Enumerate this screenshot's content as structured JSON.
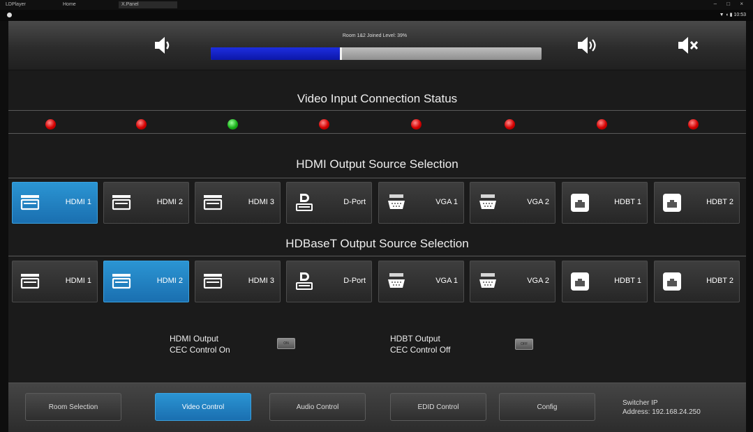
{
  "window": {
    "tabs": [
      "LDPlayer",
      "Home",
      "X.Panel"
    ],
    "controls": "– □ ×"
  },
  "status_bar": {
    "system": "▼ ◖ ▮ 10:53"
  },
  "volume": {
    "label": "Room 1&2 Joined Level: 39%",
    "level_fraction": 0.39,
    "down_icon": "volume-down-icon",
    "up_icon": "volume-up-icon",
    "mute_icon": "volume-mute-icon"
  },
  "video_status": {
    "title": "Video Input Connection Status",
    "inputs": [
      "red",
      "red",
      "green",
      "red",
      "red",
      "red",
      "red",
      "red"
    ]
  },
  "hdmi_output": {
    "title": "HDMI Output Source Selection",
    "selected_index": 0
  },
  "hdbaset_output": {
    "title": "HDBaseT Output Source Selection",
    "selected_index": 1
  },
  "sources": [
    {
      "label": "HDMI 1",
      "icon": "hdmi-icon"
    },
    {
      "label": "HDMI 2",
      "icon": "hdmi-icon"
    },
    {
      "label": "HDMI 3",
      "icon": "hdmi-icon"
    },
    {
      "label": "D-Port",
      "icon": "displayport-icon"
    },
    {
      "label": "VGA 1",
      "icon": "vga-icon"
    },
    {
      "label": "VGA 2",
      "icon": "vga-icon"
    },
    {
      "label": "HDBT 1",
      "icon": "ethernet-icon"
    },
    {
      "label": "HDBT 2",
      "icon": "ethernet-icon"
    }
  ],
  "cec": {
    "hdmi": {
      "line1": "HDMI Output",
      "line2": "CEC Control On",
      "button": "ON"
    },
    "hdbt": {
      "line1": "HDBT Output",
      "line2": "CEC Control Off",
      "button": "OFF"
    }
  },
  "nav": [
    {
      "label": "Room Selection"
    },
    {
      "label": "Video Control"
    },
    {
      "label": "Audio Control"
    },
    {
      "label": "EDID Control"
    },
    {
      "label": "Config"
    }
  ],
  "nav_selected_index": 1,
  "switcher": {
    "line1": "Switcher IP",
    "line2": "Address: 192.168.24.250"
  },
  "colors": {
    "accent": "#1f86c8",
    "volume_fill": "#1424c8",
    "led_on": "#19b219",
    "led_off": "#d40000"
  }
}
